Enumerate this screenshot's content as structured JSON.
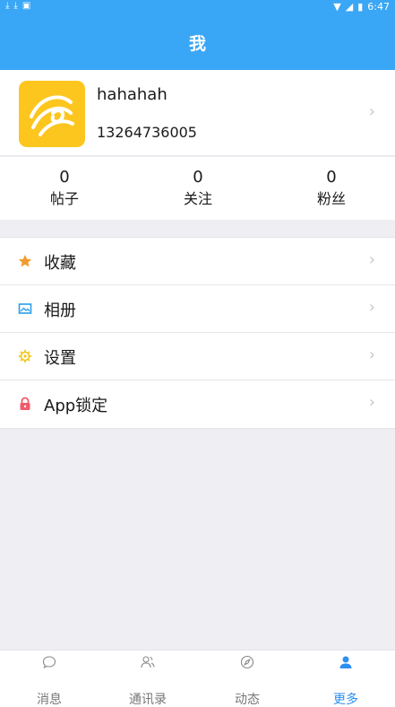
{
  "status_bar": {
    "time": "6:47"
  },
  "header": {
    "title": "我"
  },
  "profile": {
    "username": "hahahah",
    "phone": "13264736005"
  },
  "stats": [
    {
      "value": "0",
      "label": "帖子"
    },
    {
      "value": "0",
      "label": "关注"
    },
    {
      "value": "0",
      "label": "粉丝"
    }
  ],
  "menu": [
    {
      "label": "收藏",
      "icon": "star-icon",
      "color": "#f39a2d"
    },
    {
      "label": "相册",
      "icon": "image-icon",
      "color": "#2a9fe8"
    },
    {
      "label": "设置",
      "icon": "gear-icon",
      "color": "#f0c419"
    },
    {
      "label": "App锁定",
      "icon": "lock-icon",
      "color": "#ef5b6b"
    }
  ],
  "tabs": [
    {
      "label": "消息",
      "icon": "chat-icon",
      "active": false
    },
    {
      "label": "通讯录",
      "icon": "contacts-icon",
      "active": false
    },
    {
      "label": "动态",
      "icon": "compass-icon",
      "active": false
    },
    {
      "label": "更多",
      "icon": "user-icon",
      "active": true
    }
  ],
  "colors": {
    "primary": "#3aa6f6",
    "active_tab": "#2d8ff0",
    "avatar_bg": "#fcc61f"
  }
}
